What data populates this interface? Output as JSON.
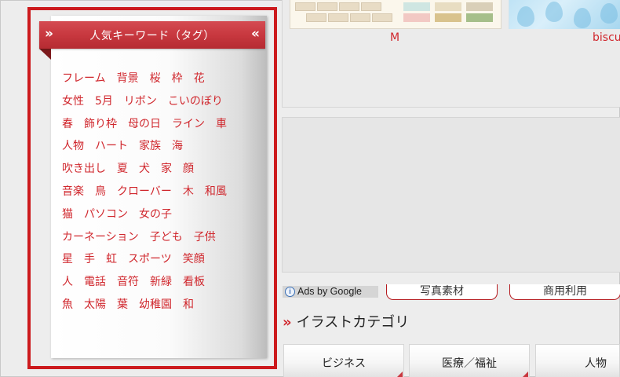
{
  "sidebar": {
    "title": "人気キーワード（タグ）",
    "chevron_left": "»",
    "chevron_right": "«",
    "tags": [
      [
        "フレーム",
        "背景",
        "桜",
        "枠",
        "花"
      ],
      [
        "女性",
        "5月",
        "リボン",
        "こいのぼり"
      ],
      [
        "春",
        "飾り枠",
        "母の日",
        "ライン",
        "車"
      ],
      [
        "人物",
        "ハート",
        "家族",
        "海"
      ],
      [
        "吹き出し",
        "夏",
        "犬",
        "家",
        "顔"
      ],
      [
        "音楽",
        "鳥",
        "クローバー",
        "木",
        "和風"
      ],
      [
        "猫",
        "パソコン",
        "女の子"
      ],
      [
        "カーネーション",
        "子ども",
        "子供"
      ],
      [
        "星",
        "手",
        "虹",
        "スポーツ",
        "笑顔"
      ],
      [
        "人",
        "電話",
        "音符",
        "新緑",
        "看板"
      ],
      [
        "魚",
        "太陽",
        "葉",
        "幼稚園",
        "和"
      ]
    ],
    "accent_color": "#d0272d",
    "outline_color": "#cc1a1d"
  },
  "thumbnails": [
    {
      "label": "M"
    },
    {
      "label": "biscu"
    }
  ],
  "ads": {
    "badge_label": "Ads by Google",
    "info_glyph": "i",
    "links": [
      "写真素材",
      "商用利用"
    ]
  },
  "category": {
    "chevron": "»",
    "heading": "イラストカテゴリ",
    "buttons": [
      "ビジネス",
      "医療／福祉",
      "人物"
    ]
  }
}
